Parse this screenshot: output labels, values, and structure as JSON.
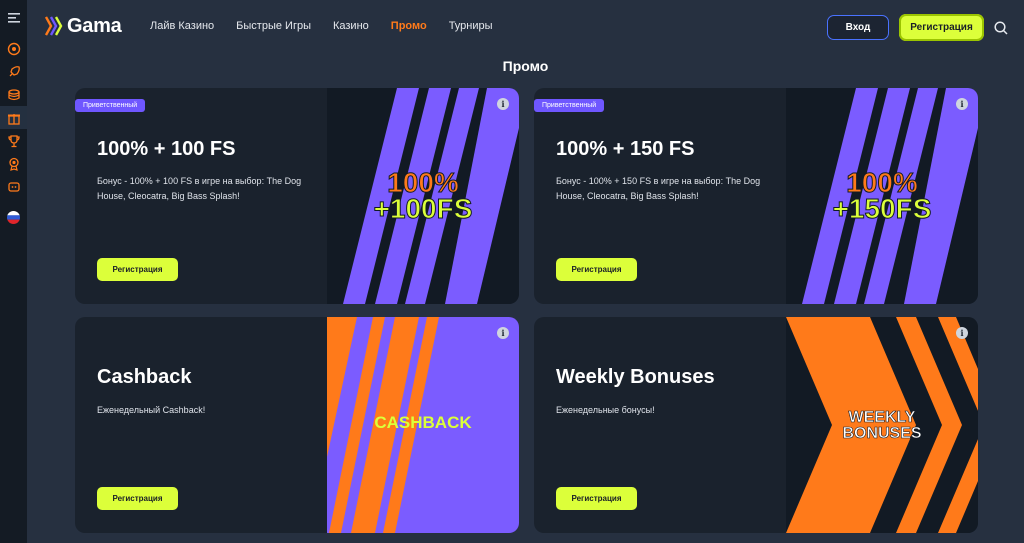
{
  "header": {
    "logo_text": "Gama",
    "nav": [
      {
        "label": "Лайв Казино"
      },
      {
        "label": "Быстрые Игры"
      },
      {
        "label": "Казино"
      },
      {
        "label": "Промо"
      },
      {
        "label": "Турниры"
      }
    ],
    "active_nav": "Промо",
    "login_label": "Вход",
    "register_label": "Регистрация"
  },
  "sidebar": {
    "items": [
      "menu-icon",
      "casino-chip-icon",
      "rocket-icon",
      "coins-icon",
      "gift-icon",
      "trophy-icon",
      "medal-icon",
      "chat-icon",
      "russia-flag-icon"
    ]
  },
  "page": {
    "title": "Промо"
  },
  "promos": [
    {
      "badge": "Приветственный",
      "title": "100% + 100 FS",
      "description": "Бонус - 100% + 100 FS в игре на выбор: The Dog House, Cleocatra, Big Bass Splash!",
      "cta": "Регистрация",
      "art_line1": "100%",
      "art_line2": "+100FS"
    },
    {
      "badge": "Приветственный",
      "title": "100% + 150 FS",
      "description": "Бонус - 100% + 150 FS в игре на выбор: The Dog House, Cleocatra, Big Bass Splash!",
      "cta": "Регистрация",
      "art_line1": "100%",
      "art_line2": "+150FS"
    },
    {
      "title": "Cashback",
      "description": "Еженедельный Cashback!",
      "cta": "Регистрация",
      "art_line1": "CASHBACK"
    },
    {
      "title": "Weekly Bonuses",
      "description": "Еженедельные бонусы!",
      "cta": "Регистрация",
      "art_line1": "WEEKLY",
      "art_line2": "BONUSES"
    }
  ],
  "colors": {
    "background": "#263040",
    "card": "#1a222d",
    "accent_lime": "#dcff3a",
    "accent_orange": "#ff7a1a",
    "accent_purple": "#7b5cff",
    "login_border": "#4a72ff"
  }
}
